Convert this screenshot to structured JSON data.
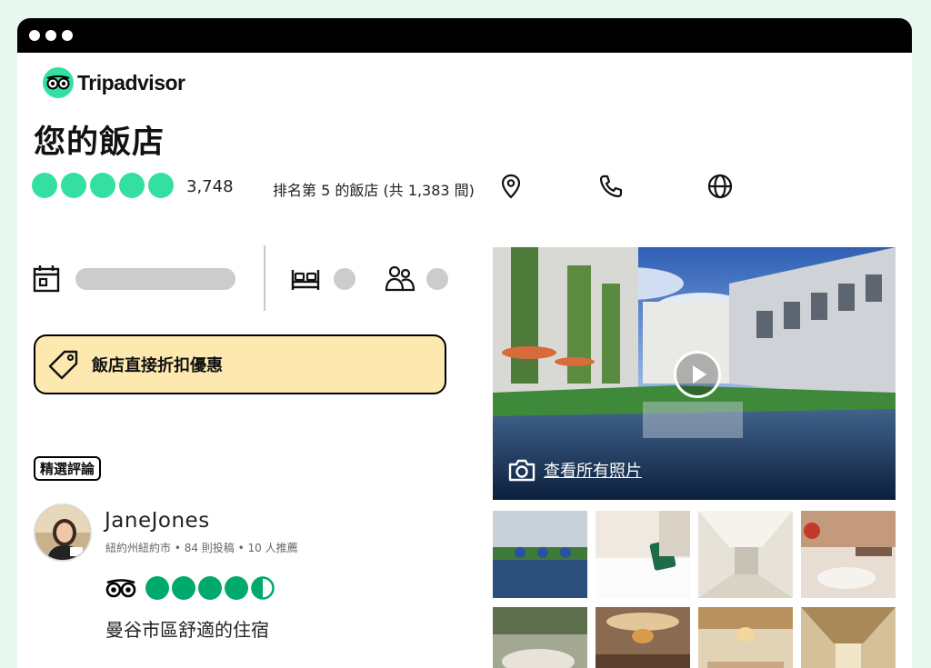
{
  "brand": {
    "name": "Tripadvisor",
    "accent": "#34e0a1"
  },
  "hotel": {
    "title": "您的飯店",
    "rating_bubbles": 5,
    "review_count": "3,748",
    "rank_text": "排名第 5 的飯店 (共 1,383 間)"
  },
  "contact_icons": [
    "location-pin-icon",
    "phone-icon",
    "globe-icon"
  ],
  "booking": {
    "date_icon": "calendar-icon",
    "rooms_icon": "bed-icon",
    "guests_icon": "guests-icon"
  },
  "deal": {
    "label": "飯店直接折扣優惠",
    "icon": "tag-icon",
    "bg": "#fde9b0"
  },
  "featured": {
    "badge": "精選評論",
    "reviewer": {
      "name": "JaneJones",
      "meta": "紐約州紐約市 • 84 則投稿 • 10 人推薦"
    },
    "rating": 4.5,
    "rating_color": "#00aa6c",
    "title": "曼谷市區舒適的住宿"
  },
  "photos": {
    "view_all_label": "查看所有照片",
    "camera_icon": "camera-icon",
    "play_icon": "play-icon"
  }
}
